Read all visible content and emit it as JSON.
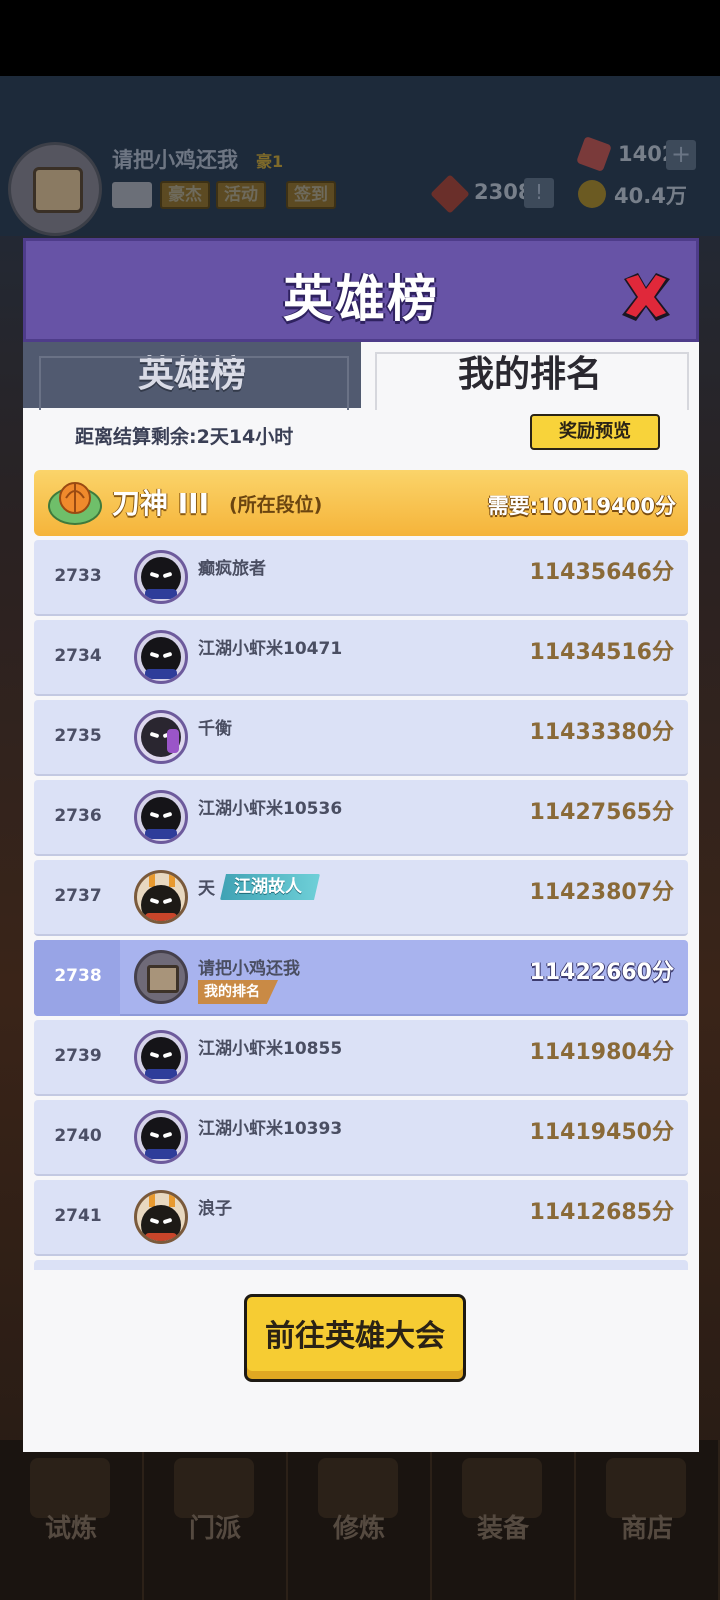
{
  "background": {
    "player": {
      "name": "请把小鸡还我",
      "rank_tag": "豪1"
    },
    "buttons": [
      "豪杰",
      "活动",
      "签到"
    ],
    "resources": {
      "gems": "1402",
      "tickets": "2308",
      "coins": "40.4万"
    },
    "plus_label": "+",
    "warn_label": "!",
    "nav": [
      "试炼",
      "门派",
      "修炼",
      "装备",
      "商店"
    ]
  },
  "dialog": {
    "title": "英雄榜",
    "tabs": [
      {
        "label": "英雄榜",
        "active": false
      },
      {
        "label": "我的排名",
        "active": true
      }
    ],
    "countdown": "距离结算剩余:2天14小时",
    "reward_preview": "奖励预览",
    "tier": {
      "name": "刀神 III",
      "sub": "(所在段位)",
      "requirement": "需要:10019400分"
    },
    "rows": [
      {
        "rank": "2733",
        "name": "癫疯旅者",
        "score": "11435646分",
        "avatar": "ninja"
      },
      {
        "rank": "2734",
        "name": "江湖小虾米10471",
        "score": "11434516分",
        "avatar": "ninja"
      },
      {
        "rank": "2735",
        "name": "千衡",
        "score": "11433380分",
        "avatar": "girl"
      },
      {
        "rank": "2736",
        "name": "江湖小虾米10536",
        "score": "11427565分",
        "avatar": "ninja"
      },
      {
        "rank": "2737",
        "name": "天",
        "badge": "江湖故人",
        "score": "11423807分",
        "avatar": "rabbit"
      },
      {
        "rank": "2738",
        "name": "请把小鸡还我",
        "badge_mine": "我的排名",
        "score": "11422660分",
        "avatar": "chest",
        "mine": true
      },
      {
        "rank": "2739",
        "name": "江湖小虾米10855",
        "score": "11419804分",
        "avatar": "ninja"
      },
      {
        "rank": "2740",
        "name": "江湖小虾米10393",
        "score": "11419450分",
        "avatar": "ninja"
      },
      {
        "rank": "2741",
        "name": "浪子",
        "score": "11412685分",
        "avatar": "rabbit"
      }
    ],
    "go_button": "前往英雄大会"
  },
  "colors": {
    "header": "#6753a6",
    "row": "#dbe1f6",
    "row_mine": "#a8b3ee",
    "button": "#f6cc33",
    "tier": "#f5b43a"
  }
}
